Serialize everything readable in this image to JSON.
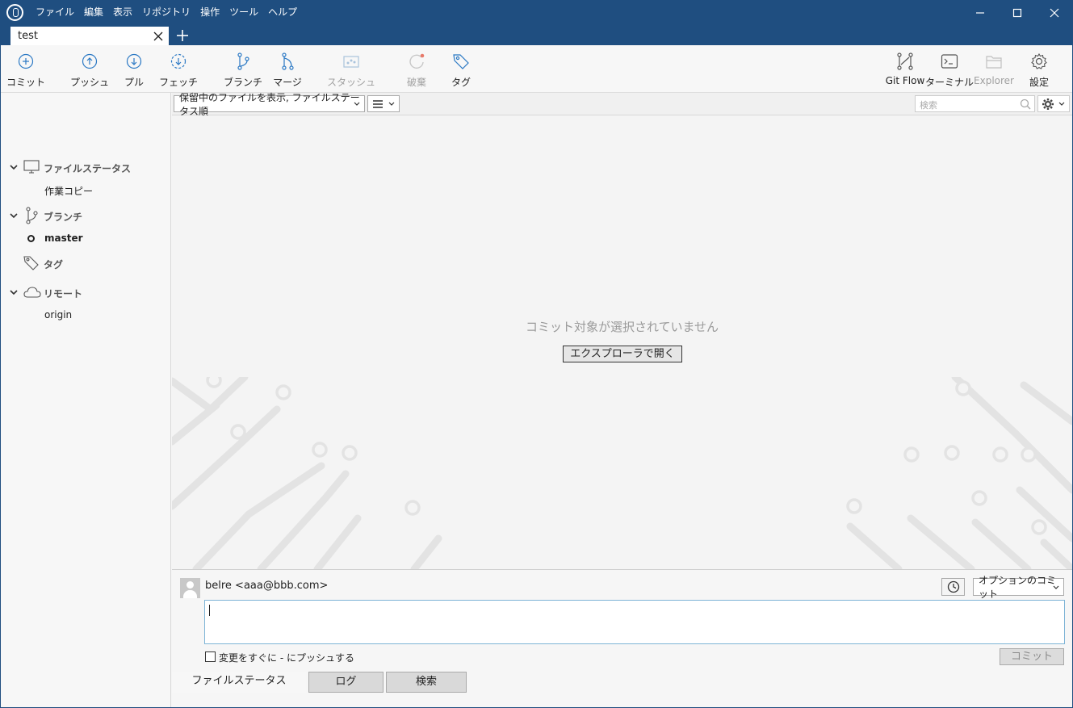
{
  "menu": [
    "ファイル",
    "編集",
    "表示",
    "リポジトリ",
    "操作",
    "ツール",
    "ヘルプ"
  ],
  "window_controls": {
    "minimize": "—",
    "maximize": "☐",
    "close": "✕"
  },
  "tab": {
    "label": "test",
    "close": "✕",
    "add": "+"
  },
  "toolbar": {
    "commit": "コミット",
    "push": "プッシュ",
    "pull": "プル",
    "fetch": "フェッチ",
    "branch": "ブランチ",
    "merge": "マージ",
    "stash": "スタッシュ",
    "discard": "破棄",
    "tag": "タグ",
    "gitflow": "Git Flow",
    "terminal": "ターミナル",
    "explorer": "Explorer",
    "settings": "設定"
  },
  "sidebar": {
    "file_status": "ファイルステータス",
    "working_copy": "作業コピー",
    "branches": "ブランチ",
    "master": "master",
    "tags": "タグ",
    "remotes": "リモート",
    "origin": "origin"
  },
  "filter": {
    "view_dropdown": "保留中のファイルを表示, ファイルステータス順",
    "search_placeholder": "検索"
  },
  "main": {
    "empty_message": "コミット対象が選択されていません",
    "open_explorer": "エクスプローラで開く"
  },
  "commit": {
    "user": "belre <aaa@bbb.com>",
    "options": "オプションのコミット",
    "push_now": "変更をすぐに - にプッシュする",
    "commit_button": "コミット"
  },
  "bottom_tabs": [
    "ファイルステータス",
    "ログ",
    "検索"
  ]
}
